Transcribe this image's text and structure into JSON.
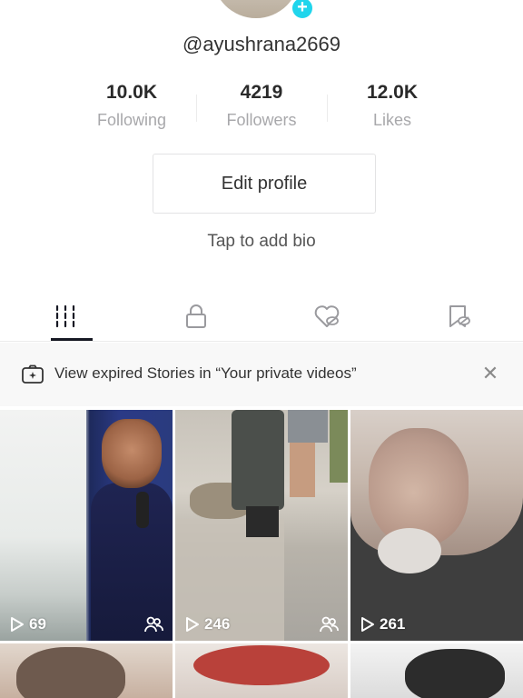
{
  "profile": {
    "username": "@ayushrana2669",
    "edit_profile_label": "Edit profile",
    "bio_placeholder": "Tap to add bio"
  },
  "stats": [
    {
      "value": "10.0K",
      "label": "Following"
    },
    {
      "value": "4219",
      "label": "Followers"
    },
    {
      "value": "12.0K",
      "label": "Likes"
    }
  ],
  "tabs": [
    {
      "icon": "grid-icon",
      "active": true
    },
    {
      "icon": "lock-icon",
      "active": false
    },
    {
      "icon": "liked-hidden-icon",
      "active": false
    },
    {
      "icon": "bookmark-hidden-icon",
      "active": false
    }
  ],
  "banner": {
    "text": "View expired Stories in “Your private videos”",
    "icon": "stories-camera-icon",
    "close_icon": "close-icon"
  },
  "videos": [
    {
      "views": "69",
      "shared": true
    },
    {
      "views": "246",
      "shared": true
    },
    {
      "views": "261",
      "shared": false
    },
    {
      "views": "",
      "shared": false
    },
    {
      "views": "",
      "shared": false
    },
    {
      "views": "",
      "shared": false
    }
  ],
  "colors": {
    "accent": "#20d5ec",
    "text_primary": "#161823",
    "text_muted": "#a8a8ab"
  }
}
